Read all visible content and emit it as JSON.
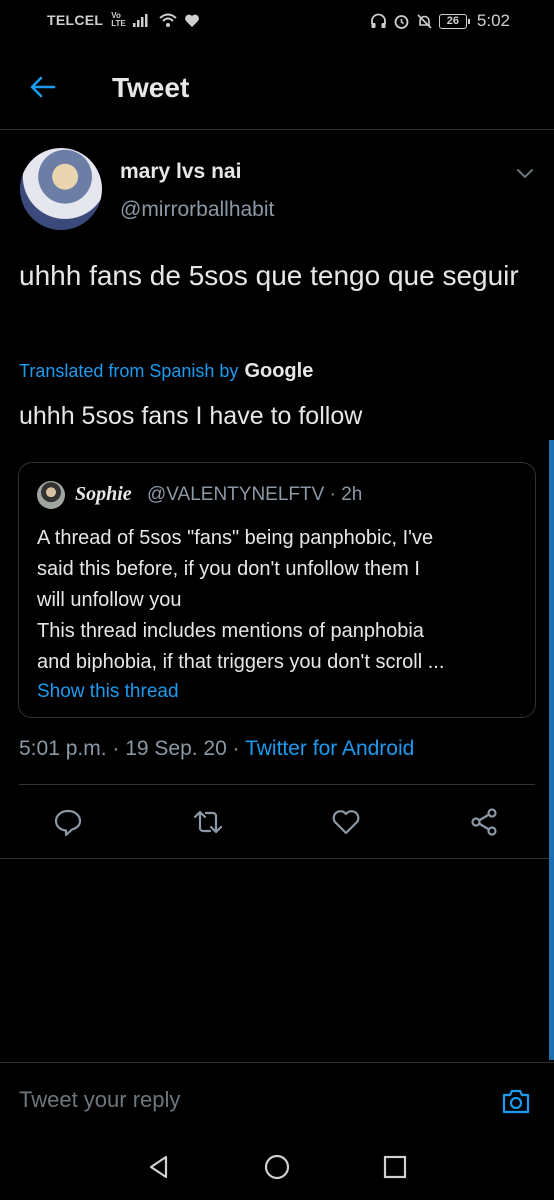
{
  "status_bar": {
    "carrier": "TELCEL",
    "volte_top": "Vo",
    "volte_bottom": "LTE",
    "battery": "26",
    "time": "5:02"
  },
  "header": {
    "title": "Tweet",
    "back_icon": "arrow-left-icon"
  },
  "tweet": {
    "display_name": "mary lvs nai",
    "handle": "@mirrorballhabit",
    "text": "uhhh fans de 5sos que tengo que seguir",
    "translated_label": "Translated from Spanish by",
    "translator": "Google",
    "translation": "uhhh 5sos fans I have to follow",
    "timestamp": "5:01 p.m. · 19 Sep. 20 · ",
    "source": "Twitter for Android"
  },
  "quote": {
    "name": "Sophie",
    "meta": "@VALENTYNELFTV · 2h",
    "lines": [
      "A thread of 5sos \"fans\" being panphobic, I've",
      "said this before, if you don't unfollow them I",
      "will unfollow you",
      "This thread includes mentions of panphobia",
      "and biphobia, if that triggers you don't scroll ..."
    ],
    "show_thread": "Show this thread"
  },
  "actions": [
    "reply-icon",
    "retweet-icon",
    "like-icon",
    "share-icon"
  ],
  "reply": {
    "placeholder": "Tweet your reply"
  },
  "colors": {
    "accent": "#1d9bf0",
    "background": "#000000",
    "muted": "#8b98a5",
    "border": "#2f3336"
  }
}
